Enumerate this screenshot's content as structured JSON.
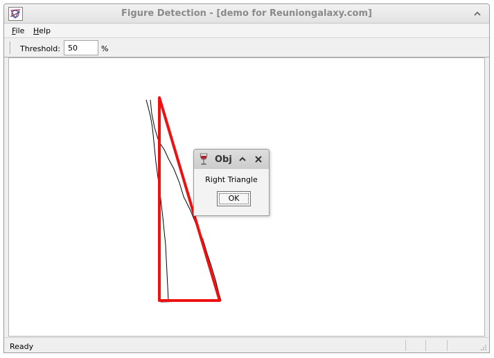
{
  "window": {
    "title": "Figure Detection - [demo for Reuniongalaxy.com]"
  },
  "menu": {
    "items": [
      {
        "label": "File",
        "mnemonic": "F",
        "rest": "ile"
      },
      {
        "label": "Help",
        "mnemonic": "H",
        "rest": "elp"
      }
    ]
  },
  "toolbar": {
    "threshold_label": "Threshold:",
    "threshold_value": "50",
    "unit": "%"
  },
  "status": {
    "text": "Ready"
  },
  "dialog": {
    "title": "Obj",
    "message": "Right Triangle",
    "ok_label": "OK"
  },
  "colors": {
    "detected_shape": "#ee1111",
    "sketch_stroke": "#000000",
    "canvas_background": "#ffffff"
  },
  "icons": {
    "app": "figure-detection-app-icon",
    "dialog": "wine-glass-icon"
  }
}
